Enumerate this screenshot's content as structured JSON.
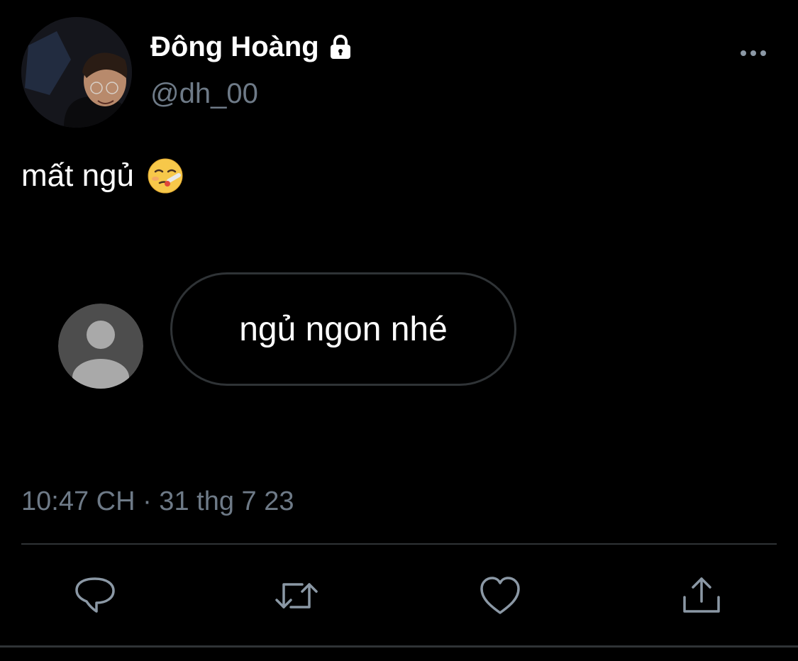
{
  "author": {
    "display_name": "Đông Hoàng",
    "handle": "@dh_00",
    "protected_icon": "lock-icon",
    "avatar_icon": "profile-photo"
  },
  "menu": {
    "more_icon": "more-horizontal-icon"
  },
  "tweet": {
    "text": "mất ngủ",
    "emoji_icon": "face-with-thermometer-emoji"
  },
  "embedded_card": {
    "avatar_icon": "default-avatar-icon",
    "bubble_text": "ngủ ngon nhé"
  },
  "meta": {
    "timestamp": "10:47 CH · 31 thg 7 23"
  },
  "actions": [
    {
      "name": "reply",
      "icon": "reply-icon"
    },
    {
      "name": "retweet",
      "icon": "retweet-icon"
    },
    {
      "name": "like",
      "icon": "heart-icon"
    },
    {
      "name": "share",
      "icon": "share-icon"
    }
  ],
  "colors": {
    "background": "#000000",
    "primary_text": "#ffffff",
    "secondary_text": "#6e7a87",
    "divider": "#2f3336",
    "icon": "#8b98a5"
  }
}
